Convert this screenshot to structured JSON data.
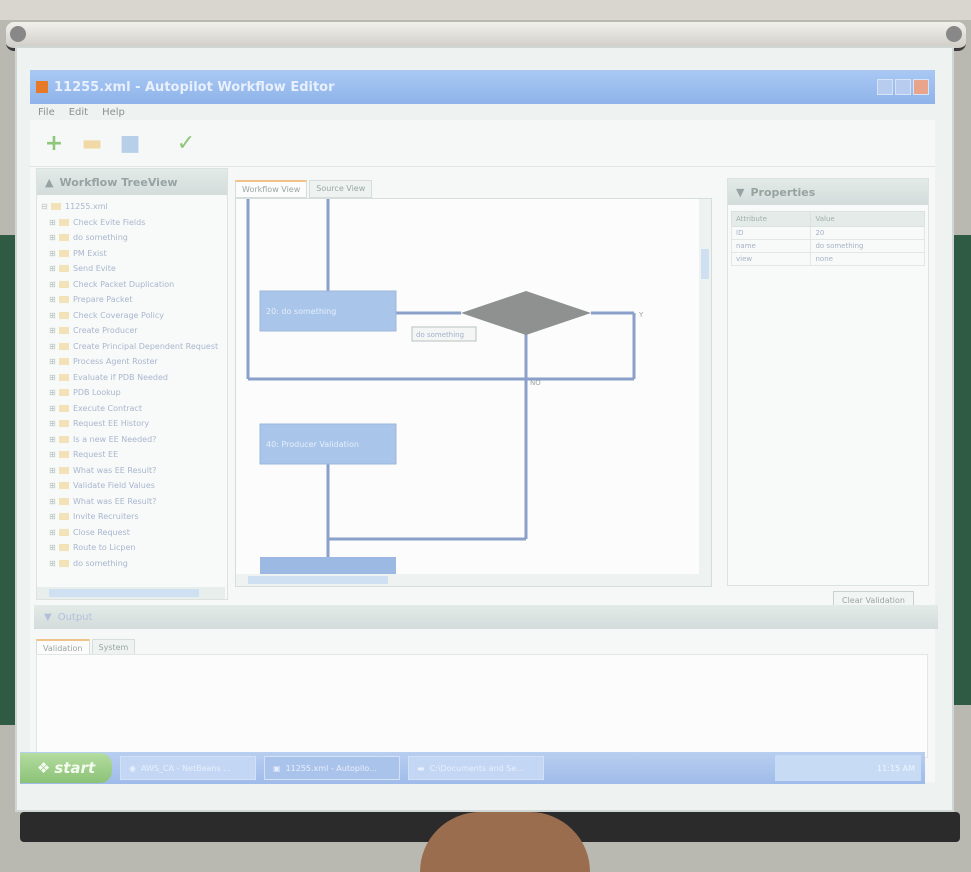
{
  "window": {
    "title": "11255.xml - Autopilot Workflow Editor",
    "menu": [
      "File",
      "Edit",
      "Help"
    ]
  },
  "toolbar": {
    "icons": [
      "add-icon",
      "open-folder-icon",
      "save-icon",
      "validate-checkmark-icon"
    ]
  },
  "tree": {
    "header": "Workflow TreeView",
    "root": "11255.xml",
    "items": [
      "Check Evite Fields",
      "do something",
      "PM Exist",
      "Send Evite",
      "Check Packet Duplication",
      "Prepare Packet",
      "Check Coverage Policy",
      "Create Producer",
      "Create Principal Dependent Request",
      "Process Agent Roster",
      "Evaluate if PDB Needed",
      "PDB Lookup",
      "Execute Contract",
      "Request EE History",
      "Is a new EE Needed?",
      "Request EE",
      "What was EE Result?",
      "Validate Field Values",
      "What was EE Result?",
      "Invite Recruiters",
      "Close Request",
      "Route to Licpen",
      "do something"
    ]
  },
  "editor": {
    "tabs": [
      "Workflow View",
      "Source View"
    ],
    "active_tab": 0,
    "nodes": {
      "node1": "20: do something",
      "label": "do something",
      "node2": "40: Producer Validation",
      "edge_y": "Y",
      "edge_n": "NO"
    }
  },
  "properties": {
    "header": "Properties",
    "columns": [
      "Attribute",
      "Value"
    ],
    "rows": [
      [
        "ID",
        "20"
      ],
      [
        "name",
        "do something"
      ],
      [
        "view",
        "none"
      ]
    ]
  },
  "output": {
    "header": "Output",
    "clear_button": "Clear Validation",
    "tabs": [
      "Validation",
      "System"
    ]
  },
  "taskbar": {
    "start": "start",
    "tasks": [
      "AWS_CA - NetBeans ...",
      "11255.xml - Autopilo...",
      "C:\\Documents and Se..."
    ],
    "clock": "11:15 AM"
  },
  "colors": {
    "node_fill": "#a9c6ea",
    "connector": "#8a9fc9",
    "decision": "#8e918f"
  }
}
